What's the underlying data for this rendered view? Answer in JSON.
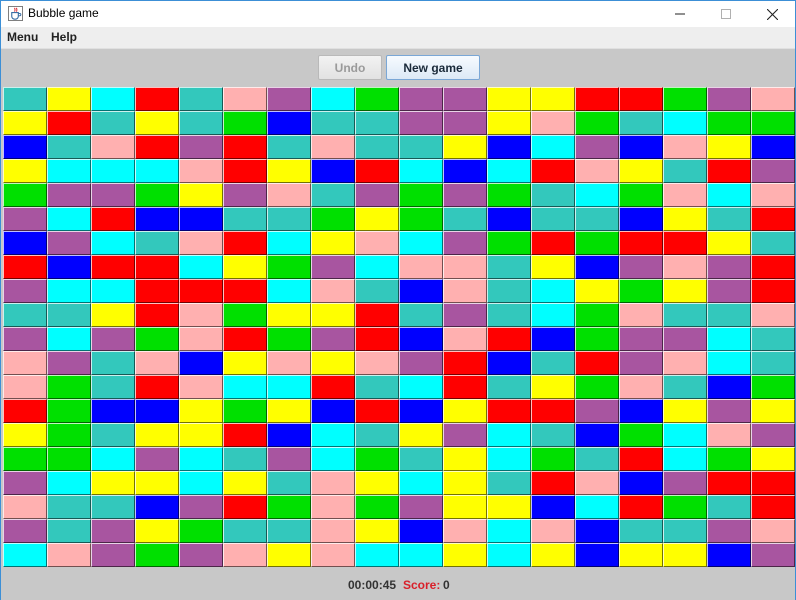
{
  "window": {
    "title": "Bubble game",
    "icon": "java-cup-icon"
  },
  "menu": {
    "items": [
      "Menu",
      "Help"
    ]
  },
  "toolbar": {
    "undo_label": "Undo",
    "undo_enabled": false,
    "new_game_label": "New game"
  },
  "palette": {
    "T": "#33c8bc",
    "Y": "#ffff00",
    "C": "#00ffff",
    "R": "#ff0000",
    "P": "#ffb0b0",
    "M": "#a855a0",
    "G": "#00e000",
    "B": "#0000ff"
  },
  "board": {
    "rows": [
      "TYCRTPMCGMMYYRRGMP",
      "YRTYTGBTTMMYPGTCGG",
      "BTPRMRTPTTYBCMBPYB",
      "YCCCPRYBRCBCRPYTRM",
      "GMMGYMPTMGMGTCGPCP",
      "MCRBBTTGYGTBTTBYTR",
      "BMCTPRCYPCMGRGRRYT",
      "RBRRCYGMCPPTYBMPMR",
      "MCCRRRCPTBPTCYGYMR",
      "TTYRPGYYRTMTCGPTTP",
      "MCMGPRGMRBPRBGMMCT",
      "PMTPBYPYPMRBTRMPCT",
      "PGTRPCCRTCRTYGPTBG",
      "RGBBYGYBRBYRRMBYMY",
      "YGTYYRBCTYMCTBGCPM",
      "GGCMCTMCGTYCGTRCGY",
      "MCYYCYTPYCYTRPBMRR",
      "PTTBMRGPGMYYBCRGTR",
      "MTMYGTTPYBPCPBTTMP",
      "CPMGMPYPCCYCYBYYBM"
    ]
  },
  "status": {
    "time": "00:00:45",
    "score_label": "Score:",
    "score_value": "0"
  }
}
